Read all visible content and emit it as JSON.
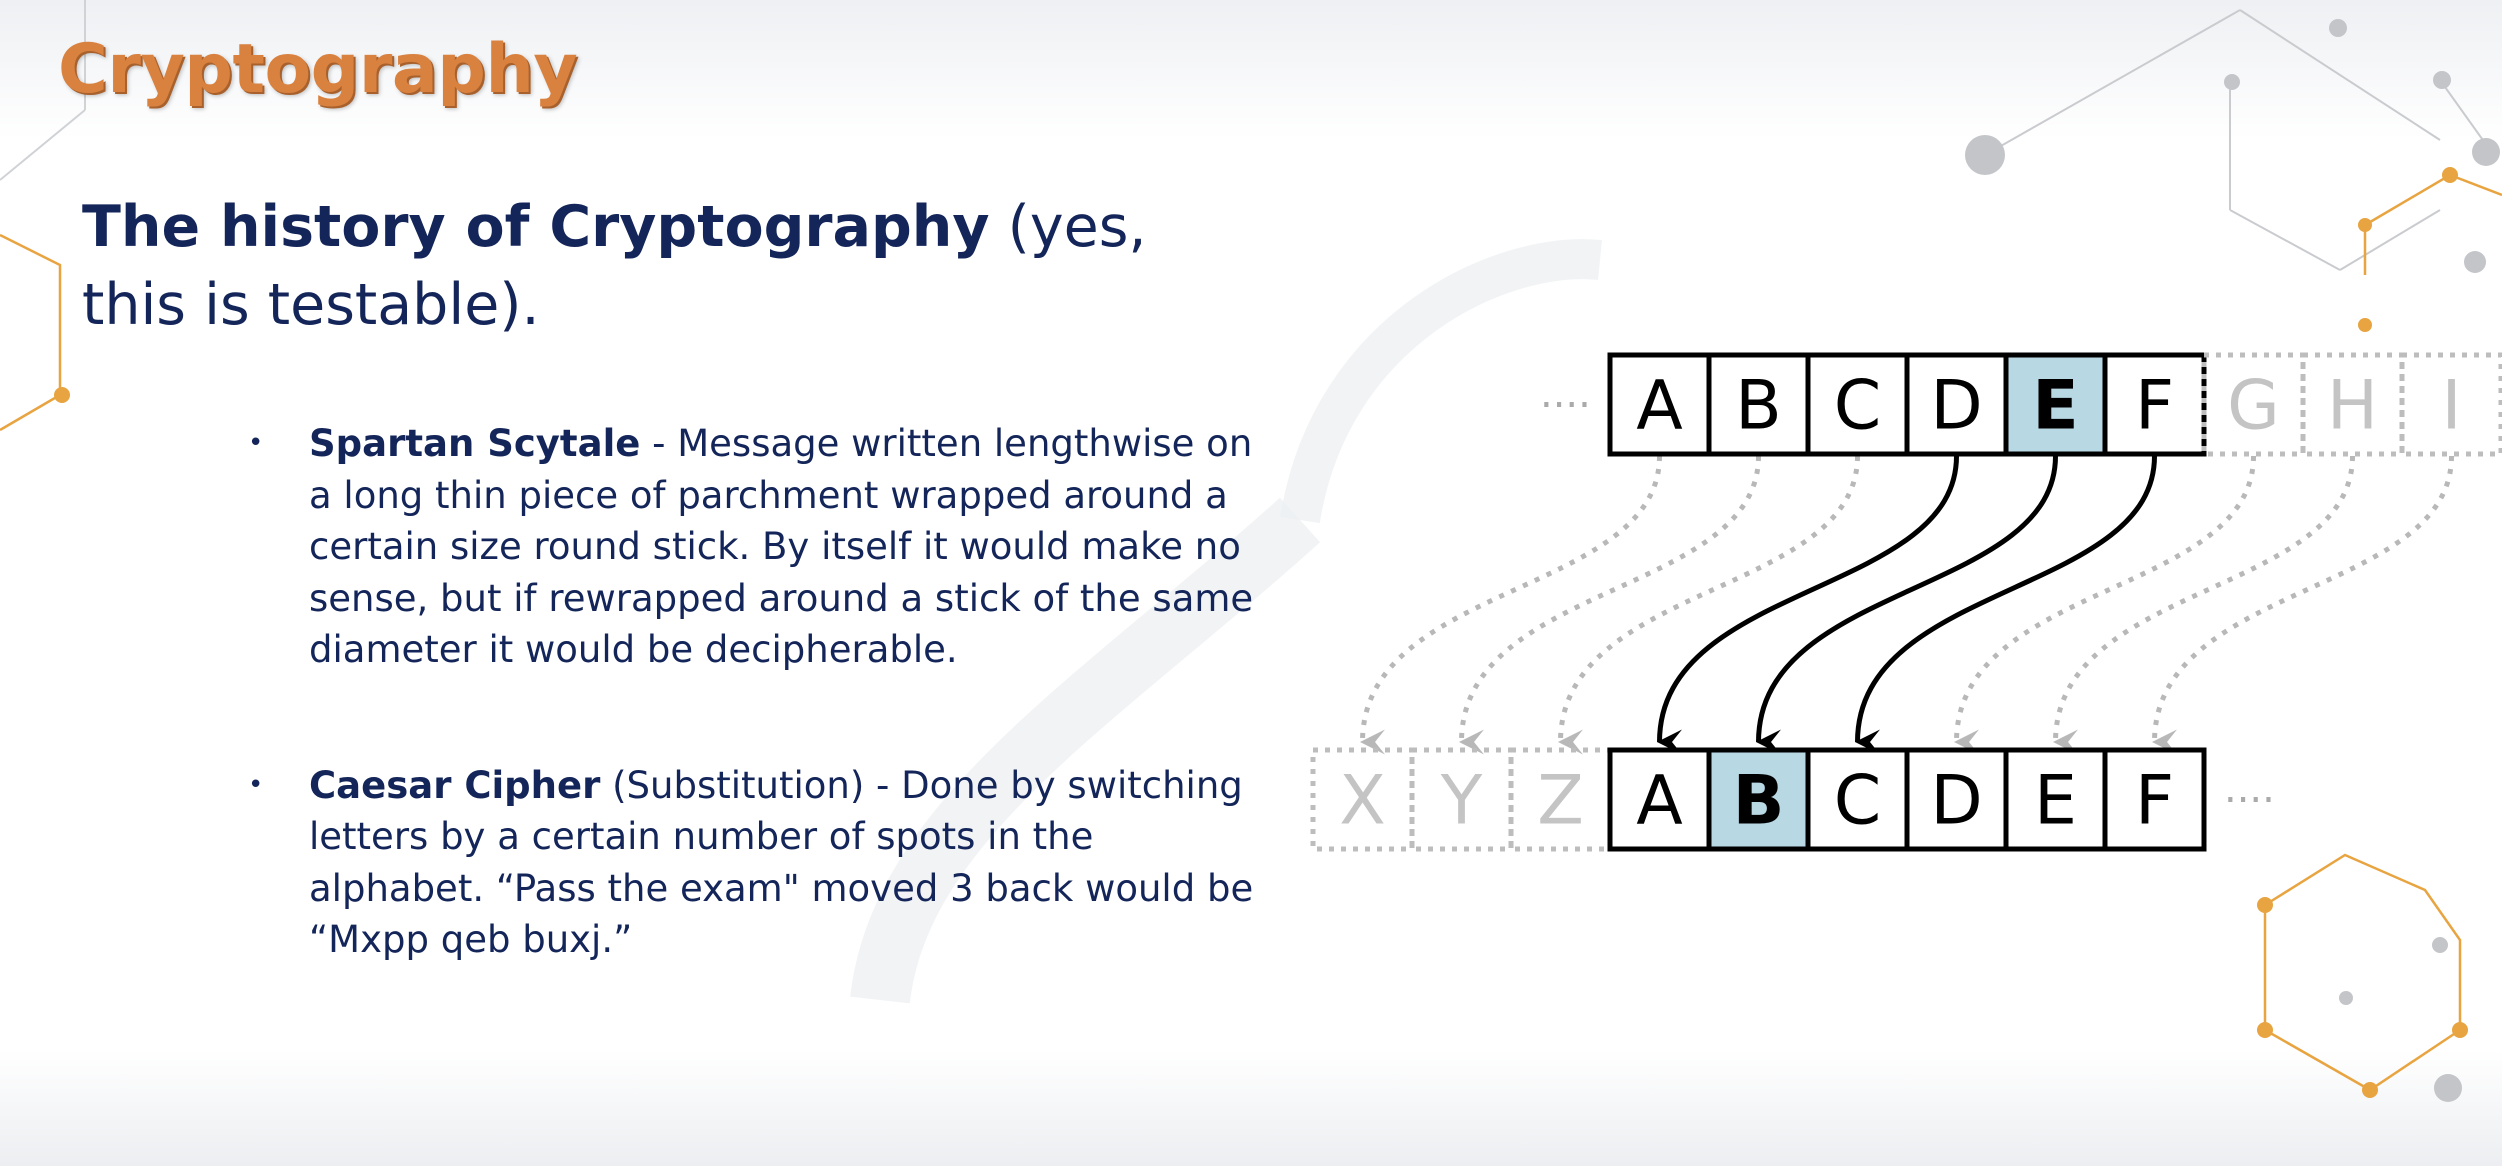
{
  "slide": {
    "title": "Cryptography",
    "heading_bold": "The history of Cryptography",
    "heading_rest": " (yes, this is testable)."
  },
  "bullets": [
    {
      "term": "Spartan Scytale",
      "text": " - Message written lengthwise on a long thin piece of parchment wrapped around a certain size round stick. By itself it would make no sense, but if rewrapped around a stick of the same diameter it would be decipherable."
    },
    {
      "term": "Caesar Cipher",
      "text": " (Substitution) - Done by switching letters by a certain number of spots in the alphabet. “Pass the exam\" moved 3 back would be “Mxpp qeb buxj.”"
    }
  ],
  "cipher_diagram": {
    "top_row": [
      "A",
      "B",
      "C",
      "D",
      "E",
      "F"
    ],
    "top_row_faded": [
      "G",
      "H",
      "I"
    ],
    "top_highlight": "E",
    "bottom_row_faded": [
      "X",
      "Y",
      "Z"
    ],
    "bottom_row": [
      "A",
      "B",
      "C",
      "D",
      "E",
      "F"
    ],
    "bottom_highlight": "B",
    "ellipsis": "····",
    "highlight_color": "#b8d8e4"
  },
  "colors": {
    "title": "#d9813f",
    "text": "#132559",
    "accent_gold": "#e8a440"
  }
}
